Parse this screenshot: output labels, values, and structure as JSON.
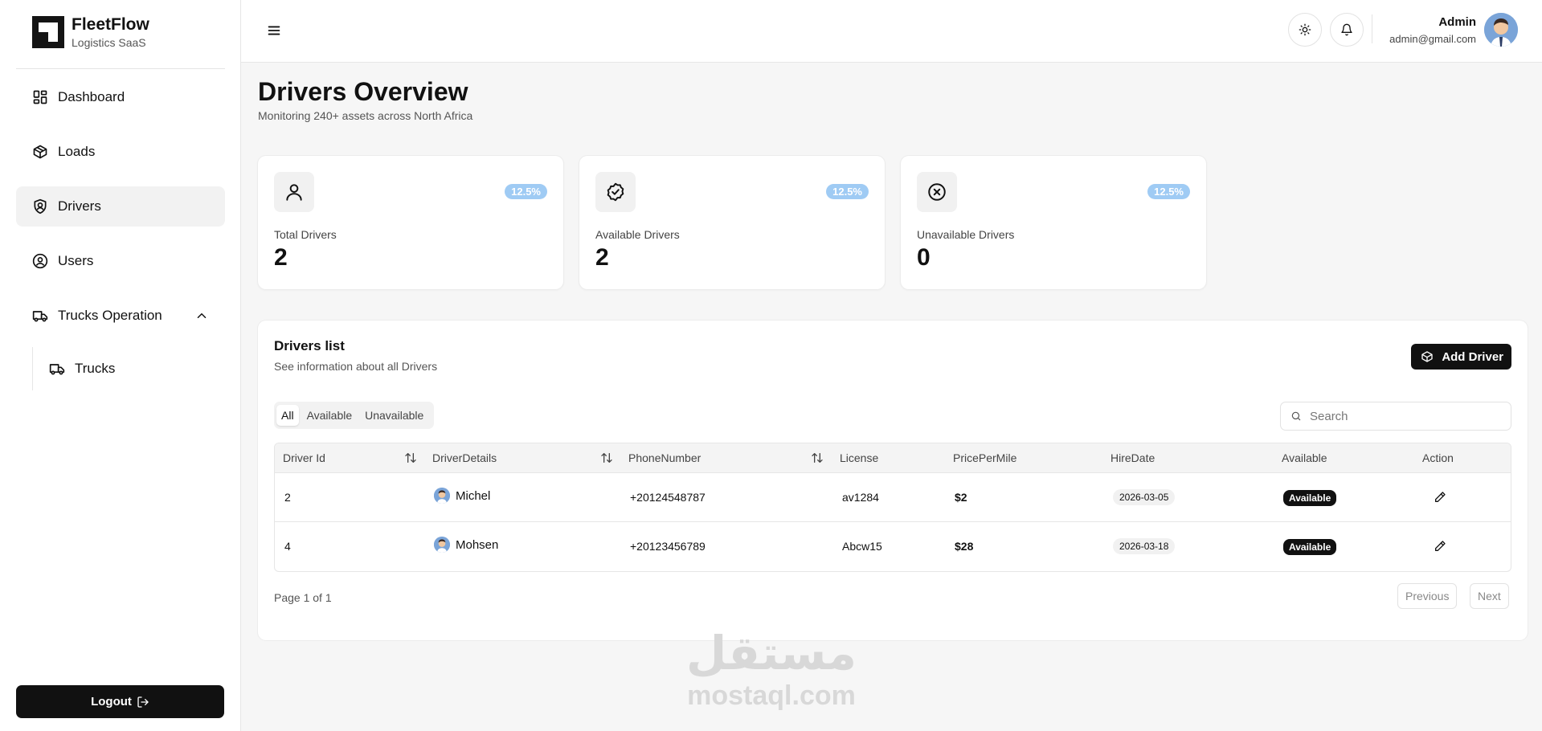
{
  "brand": {
    "name": "FleetFlow",
    "subtitle": "Logistics SaaS"
  },
  "sidebar": {
    "items": [
      {
        "label": "Dashboard",
        "icon": "dashboard-icon"
      },
      {
        "label": "Loads",
        "icon": "box-icon"
      },
      {
        "label": "Drivers",
        "icon": "shield-icon",
        "active": true
      },
      {
        "label": "Users",
        "icon": "user-circle-icon"
      },
      {
        "label": "Trucks Operation",
        "icon": "truck-icon",
        "expanded": true
      }
    ],
    "subitems": [
      {
        "label": "Trucks",
        "icon": "truck-icon"
      }
    ],
    "logout_label": "Logout"
  },
  "topbar": {
    "user_name": "Admin",
    "user_email": "admin@gmail.com"
  },
  "page": {
    "title": "Drivers Overview",
    "subtitle": "Monitoring 240+ assets across North Africa"
  },
  "stats": [
    {
      "label": "Total Drivers",
      "value": "2",
      "change": "12.5%",
      "icon": "user-icon"
    },
    {
      "label": "Available Drivers",
      "value": "2",
      "change": "12.5%",
      "icon": "badge-check-icon"
    },
    {
      "label": "Unavailable Drivers",
      "value": "0",
      "change": "12.5%",
      "icon": "circle-x-icon"
    }
  ],
  "drivers_list": {
    "title": "Drivers list",
    "subtitle": "See information about all Drivers",
    "add_button": "Add Driver",
    "tabs": [
      "All",
      "Available",
      "Unavailable"
    ],
    "active_tab": "All",
    "search_placeholder": "Search",
    "columns": [
      "Driver Id",
      "DriverDetails",
      "PhoneNumber",
      "License",
      "PricePerMile",
      "HireDate",
      "Available",
      "Action"
    ],
    "rows": [
      {
        "id": "2",
        "name": "Michel",
        "phone": "+20124548787",
        "license": "av1284",
        "price": "$2",
        "hire_date": "2026-03-05",
        "status": "Available"
      },
      {
        "id": "4",
        "name": "Mohsen",
        "phone": "+20123456789",
        "license": "Abcw15",
        "price": "$28",
        "hire_date": "2026-03-18",
        "status": "Available"
      }
    ],
    "pagination": {
      "info": "Page 1 of 1",
      "previous": "Previous",
      "next": "Next"
    }
  },
  "watermark": {
    "arabic": "مستقل",
    "latin": "mostaql.com"
  },
  "colors": {
    "accent_dark": "#111111",
    "badge_blue": "#9fcbf4",
    "background": "#f6f6f6"
  }
}
